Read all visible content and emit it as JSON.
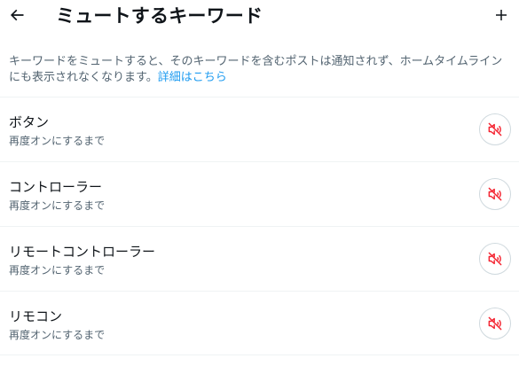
{
  "header": {
    "title": "ミュートするキーワード",
    "back_icon": "arrow-left-icon",
    "add_icon": "plus-icon"
  },
  "description": {
    "text": "キーワードをミュートすると、そのキーワードを含むポストは通知されず、ホームタイムラインにも表示されなくなります。",
    "link": "詳細はこちら"
  },
  "keywords": [
    {
      "keyword": "ボタン",
      "duration": "再度オンにするまで"
    },
    {
      "keyword": "コントローラー",
      "duration": "再度オンにするまで"
    },
    {
      "keyword": "リモートコントローラー",
      "duration": "再度オンにするまで"
    },
    {
      "keyword": "リモコン",
      "duration": "再度オンにするまで"
    }
  ],
  "colors": {
    "accent": "#1d9bf0",
    "muted_icon": "#f4212e",
    "secondary_text": "#536471"
  },
  "row_icon": "muted-speaker-icon"
}
